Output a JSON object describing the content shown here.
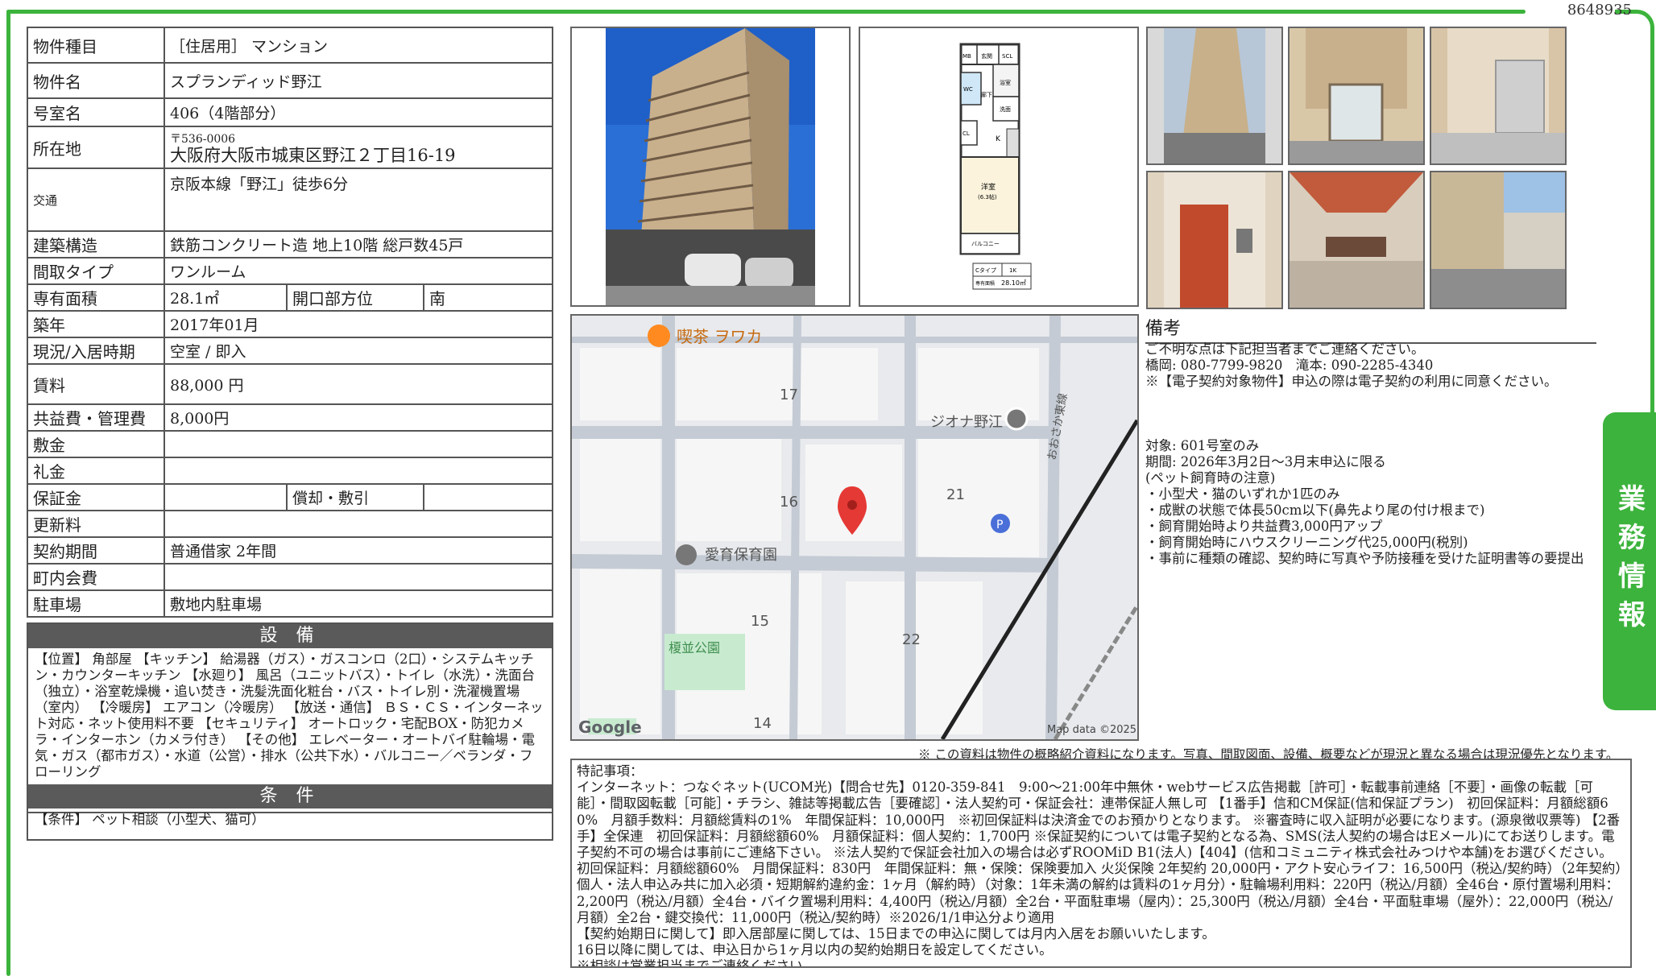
{
  "doc_id": "8648935",
  "side_tab": "業務情報",
  "property": {
    "type_label": "物件種目",
    "type_value": "［住居用］ マンション",
    "name_label": "物件名",
    "name_value": "スプランディッド野江",
    "room_label": "号室名",
    "room_value": "406（4階部分）",
    "address_label": "所在地",
    "postal": "〒536-0006",
    "address": "大阪府大阪市城東区野江２丁目16-19",
    "transport_label": "交通",
    "transport_value": "京阪本線「野江」徒歩6分",
    "structure_label": "建築構造",
    "structure_value": "鉄筋コンクリート造 地上10階 総戸数45戸",
    "layout_label": "間取タイプ",
    "layout_value": "ワンルーム",
    "area_label": "専有面積",
    "area_value": "28.1㎡",
    "direction_label": "開口部方位",
    "direction_value": "南",
    "built_label": "築年",
    "built_value": "2017年01月",
    "status_label": "現況/入居時期",
    "status_value": "空室 / 即入",
    "rent_label": "賃料",
    "rent_value": "88,000 円",
    "fee_label": "共益費・管理費",
    "fee_value": "8,000円",
    "shikikin_label": "敷金",
    "reikin_label": "礼金",
    "deposit_label": "保証金",
    "amort_label": "償却・敷引",
    "renewal_label": "更新料",
    "contract_label": "契約期間",
    "contract_value": "普通借家 2年間",
    "town_label": "町内会費",
    "parking_label": "駐車場",
    "parking_value": "敷地内駐車場"
  },
  "equipment": {
    "heading": "設 備",
    "text": "【位置】 角部屋 【キッチン】 給湯器（ガス）・ガスコンロ（2口）・システムキッチン・カウンターキッチン 【水廻り】 風呂（ユニットバス）・トイレ（水洗）・洗面台（独立）・浴室乾燥機・追い焚き・洗髪洗面化粧台・バス・トイレ別・洗濯機置場（室内） 【冷暖房】 エアコン（冷暖房） 【放送・通信】 ＢＳ・ＣＳ・インターネット対応・ネット使用料不要 【セキュリティ】 オートロック・宅配BOX・防犯カメラ・インターホン（カメラ付き） 【その他】 エレベーター・オートバイ駐輪場・電気・ガス（都市ガス）・水道（公営）・排水（公共下水）・バルコニー／ベランダ・フローリング"
  },
  "conditions": {
    "heading": "条 件",
    "text": "【条件】 ペット相談（小型犬、猫可）"
  },
  "floorplan": {
    "labels": [
      "MB",
      "玄関",
      "SCL",
      "浴室",
      "WC",
      "廊下",
      "洗面",
      "CL",
      "K",
      "洋室",
      "(6.3帖)",
      "バルコニー"
    ],
    "type": "Cタイプ",
    "type_value": "1K",
    "area_label": "専有面積",
    "area_value": "28.10㎡"
  },
  "map": {
    "places": [
      "喫茶 ヲワカ",
      "ジオナ野江",
      "愛育保育園",
      "榎並公園"
    ],
    "blocks": [
      "17",
      "16",
      "21",
      "15",
      "22",
      "14"
    ],
    "line": "おおさか東線",
    "google": "Google",
    "credit": "Map data ©2025"
  },
  "notes": {
    "title": "備考",
    "lines": [
      "ご不明な点は下記担当者までご連絡ください。",
      "橋岡: 080-7799-9820　滝本: 090-2285-4340",
      "※【電子契約対象物件】申込の際は電子契約の利用に同意ください。",
      "対象: 601号室のみ",
      "期間: 2026年3月2日～3月末申込に限る",
      "(ペット飼育時の注意)",
      "・小型犬・猫のいずれか1匹のみ",
      "・成獣の状態で体長50cm以下(鼻先より尾の付け根まで)",
      "・飼育開始時より共益費3,000円アップ",
      "・飼育開始時にハウスクリーニング代25,000円(税別)",
      "・事前に種類の確認、契約時に写真や予防接種を受けた証明書等の要提出"
    ]
  },
  "disclaimer": "※ この資料は物件の概略紹介資料になります。写真、間取図面、設備、概要などが現況と異なる場合は現況優先となります。",
  "remarks": {
    "heading": "特記事項：",
    "body": "インターネット：つなぐネット(UCOM光)【問合せ先】0120-359-841　9:00～21:00年中無休・webサービス広告掲載［許可］・転載事前連絡［不要］・画像の転載［可能］・間取図転載［可能］・チラシ、雑誌等掲載広告［要確認］・法人契約可・保証会社：連帯保証人無し可 【1番手】信和CM保証(信和保証プラン)　初回保証料：月額総額60%　月額手数料：月額総賃料の1%　年間保証料：10,000円　※初回保証料は決済金でのお預かりとなります。 ※審査時に収入証明が必要になります。(源泉徴収票等) 【2番手】全保連　初回保証料：月額総額60%　月額保証料：個人契約：1,700円 ※保証契約については電子契約となる為、SMS(法人契約の場合はEメール)にてお送りします。電子契約不可の場合は事前にご連絡下さい。 ※法人契約で保証会社加入の場合は必ずROOMiD B1(法人)【404】(信和コミュニティ株式会社みつけや本舗)をお選びください。初回保証料：月額総額60%　月間保証料：830円　年間保証料：無・保険：保険要加入 火災保険 2年契約 20,000円・アクト安心ライフ：16,500円（税込/契約時）（2年契約）個人・法人申込み共に加入必須・短期解約違約金：1ヶ月（解約時）（対象：1年未満の解約は賃料の1ヶ月分）・駐輪場利用料：220円（税込/月額）全46台・原付置場利用料：2,200円（税込/月額）全4台・バイク置場利用料：4,400円（税込/月額）全2台・平面駐車場（屋内）：25,300円（税込/月額）全4台・平面駐車場（屋外）：22,000円（税込/月額）全2台・鍵交換代：11,000円（税込/契約時）※2026/1/1申込分より適用",
    "line2": "【契約始期日に関して】即入居部屋に関しては、15日までの申込に関しては月内入居をお願いいたします。",
    "line3": "16日以降に関しては、申込日から1ヶ月以内の契約始期日を設定してください。",
    "line4": "※相談は営業担当までご連絡ください。"
  },
  "colors": {
    "accent": "#3cb33c",
    "header_gray": "#5a5a5a",
    "map_pin": "#e53935"
  }
}
